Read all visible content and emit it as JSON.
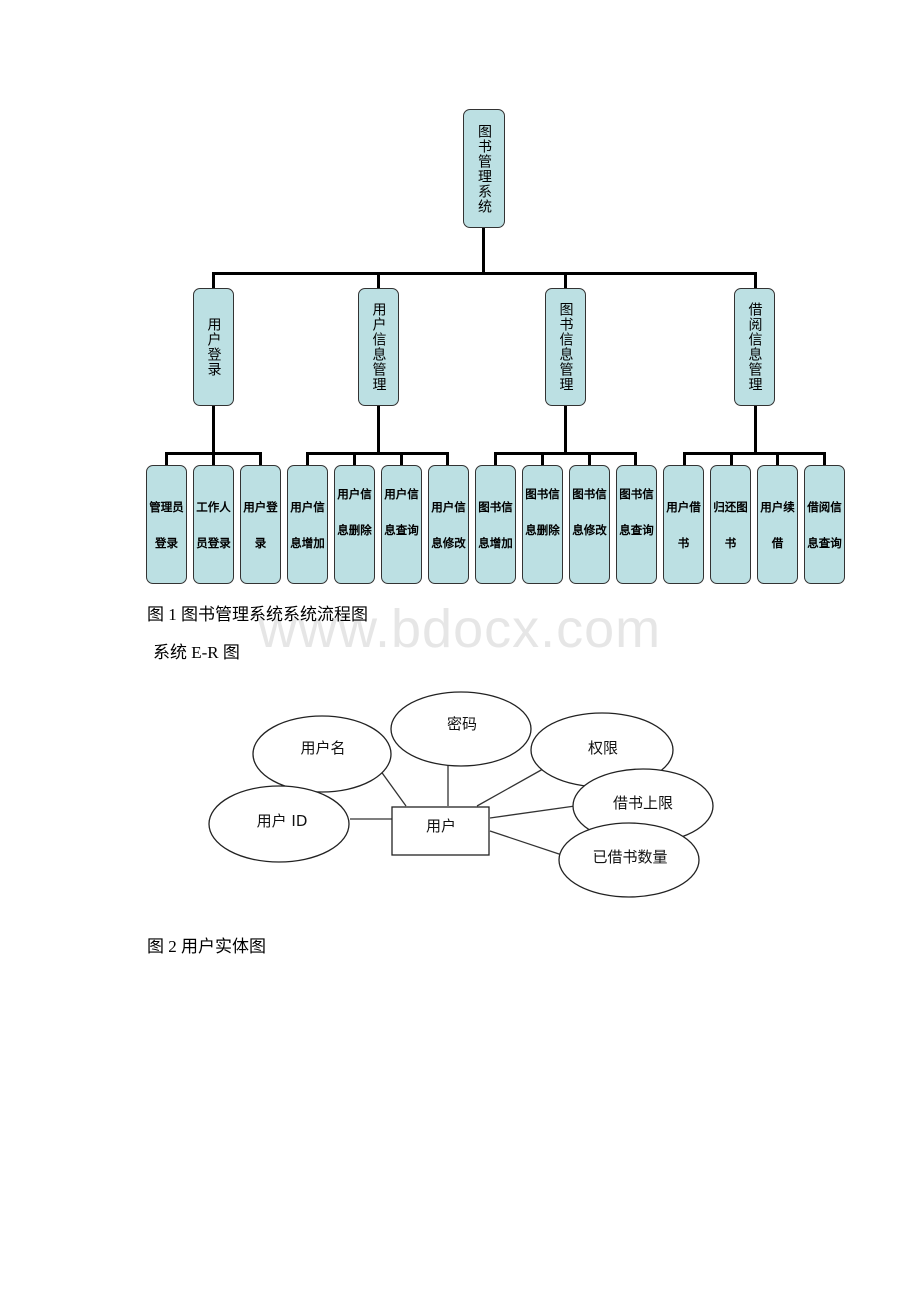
{
  "figure1": {
    "root": "图书管理系统",
    "branches": [
      {
        "label": "用户登录",
        "children": [
          "管理员登录",
          "工作人员登录",
          "用户登录"
        ]
      },
      {
        "label": "用户信息管理",
        "children": [
          "用户信息增加",
          "用户信息删除",
          "用户信息查询",
          "用户信息修改"
        ]
      },
      {
        "label": "图书信息管理",
        "children": [
          "图书信息增加",
          "图书信息删除",
          "图书信息修改",
          "图书信息查询"
        ]
      },
      {
        "label": "借阅信息管理",
        "children": [
          "用户借书",
          "归还图书",
          "用户续借",
          "借阅信息查询"
        ]
      }
    ],
    "caption": "图 1 图书管理系统系统流程图",
    "node_color": "#bce0e3"
  },
  "section_heading": "系统 E-R 图",
  "watermark": "www.bdocx.com",
  "figure2": {
    "entity": "用户",
    "attributes": [
      "用户名",
      "密码",
      "权限",
      "用户 ID",
      "借书上限",
      "已借书数量"
    ],
    "caption": "图 2 用户实体图"
  }
}
